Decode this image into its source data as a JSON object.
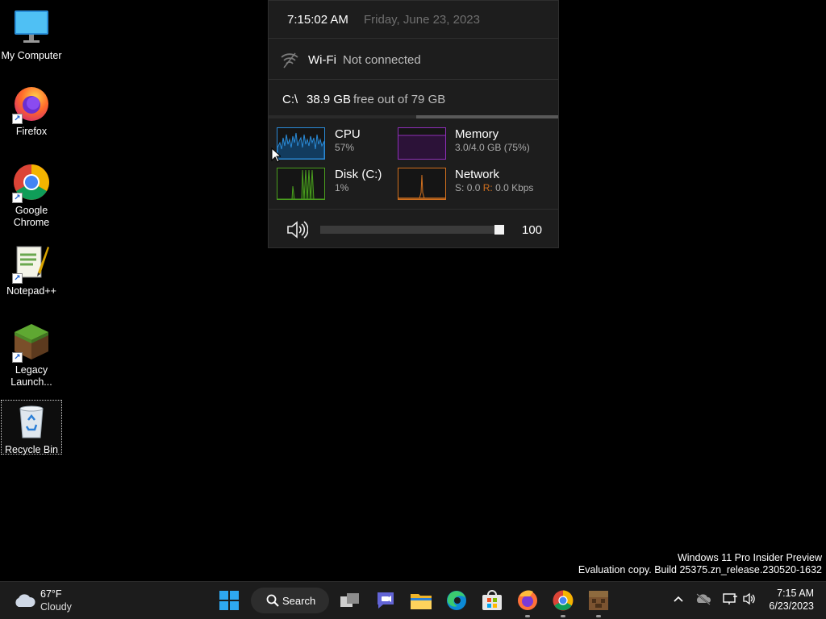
{
  "desktop": {
    "icons": [
      {
        "label": "My Computer"
      },
      {
        "label": "Firefox"
      },
      {
        "label": "Google Chrome",
        "line1": "Google",
        "line2": "Chrome"
      },
      {
        "label": "Notepad++"
      },
      {
        "label": "Legacy Launch...",
        "line1": "Legacy",
        "line2": "Launch..."
      },
      {
        "label": "Recycle Bin"
      }
    ]
  },
  "panel": {
    "time": "7:15:02 AM",
    "date": "Friday, June 23, 2023",
    "wifi": {
      "label": "Wi-Fi",
      "status": "Not connected"
    },
    "disk": {
      "drive": "C:\\",
      "free": "38.9 GB",
      "free_text": "free out of 79 GB",
      "used_fraction": 0.51
    },
    "monitors": {
      "cpu": {
        "title": "CPU",
        "value": "57%",
        "color": "#2a8ad6"
      },
      "memory": {
        "title": "Memory",
        "value": "3.0/4.0 GB (75%)",
        "color": "#8e2fb8"
      },
      "disk": {
        "title": "Disk (C:)",
        "value": "1%",
        "color": "#4a9e1e"
      },
      "network": {
        "title": "Network",
        "send_label": "S:",
        "send_value": "0.0",
        "recv_label": "R:",
        "recv_value": "0.0 Kbps",
        "color": "#d2701e"
      }
    },
    "volume": {
      "value": "100",
      "level": 1.0
    }
  },
  "watermark": {
    "line1": "Windows 11 Pro Insider Preview",
    "line2": "Evaluation copy. Build 25375.zn_release.230520-1632"
  },
  "taskbar": {
    "weather": {
      "temp": "67°F",
      "condition": "Cloudy"
    },
    "search_label": "Search",
    "pinned": [
      "start-icon",
      "task-view-icon",
      "teams-chat-icon",
      "file-explorer-icon",
      "edge-icon",
      "microsoft-store-icon",
      "firefox-icon",
      "chrome-icon",
      "minecraft-icon"
    ],
    "clock": {
      "time": "7:15 AM",
      "date": "6/23/2023"
    }
  }
}
